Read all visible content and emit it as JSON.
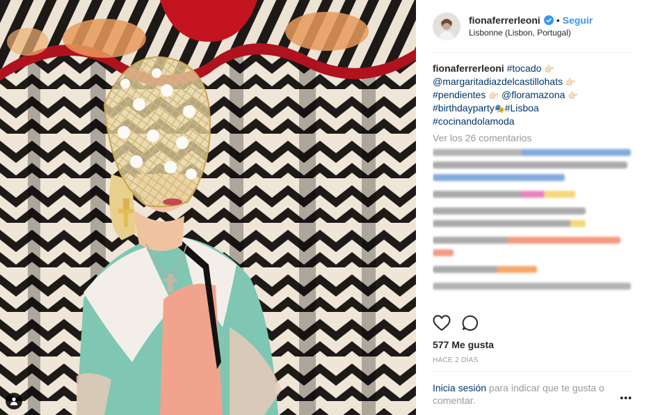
{
  "post": {
    "username": "fionaferrerleoni",
    "follow_label": "Seguir",
    "separator": "•",
    "location": "Lisbonne (Lisbon, Portugal)"
  },
  "caption": {
    "username": "fionaferrerleoni",
    "parts": [
      {
        "tag": "#tocado",
        "emoji": "👉🏻"
      },
      {
        "tag": "@margaritadiazdelcastillohats",
        "emoji": "👉🏻"
      },
      {
        "tag": "#pendientes",
        "emoji": "👉🏻"
      },
      {
        "tag": "@floramazona",
        "emoji": "👉🏻"
      },
      {
        "tag": "#birthdayparty",
        "emoji": "🎭"
      },
      {
        "tag": "#Lisboa",
        "emoji": ""
      },
      {
        "tag": "#cocinandolamoda",
        "emoji": ""
      }
    ]
  },
  "view_all_comments": "Ver los 26 comentarios",
  "likes": "577 Me gusta",
  "time_ago": "HACE 2 DÍAS",
  "footer": {
    "login_link": "Inicia sesión",
    "rest": " para indicar que te gusta o comentar."
  },
  "more_label": "•••",
  "icons": {
    "like": "heart-icon",
    "comment": "comment-icon",
    "verified": "verified-badge-icon",
    "tag": "user-tag-icon"
  },
  "colors": {
    "link": "#3897f0",
    "hashtag": "#003569",
    "muted": "#999999"
  }
}
